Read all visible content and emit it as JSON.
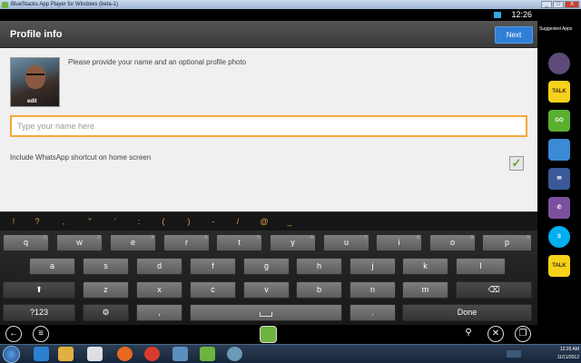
{
  "window": {
    "title": "BlueStacks App Player for Windows (beta-1)",
    "buttons": [
      "_",
      "□",
      "X"
    ]
  },
  "status_bar": {
    "time": "12:26"
  },
  "header": {
    "title": "Profile info",
    "next_label": "Next"
  },
  "profile": {
    "photo_edit_label": "edit",
    "prompt": "Please provide your name and an optional profile photo",
    "name_placeholder": "Type your name here",
    "shortcut_label": "Include WhatsApp shortcut on home screen",
    "shortcut_checked": true,
    "accent_color": "#f3a73c"
  },
  "symbols": [
    "!",
    "?",
    ",",
    "\"",
    "'",
    ":",
    "(",
    ")",
    "-",
    "/",
    "@",
    "_"
  ],
  "keyboard": {
    "row1": [
      {
        "key": "q",
        "hint": "1"
      },
      {
        "key": "w",
        "hint": "2"
      },
      {
        "key": "e",
        "hint": "3"
      },
      {
        "key": "r",
        "hint": "4"
      },
      {
        "key": "t",
        "hint": "5"
      },
      {
        "key": "y",
        "hint": "6"
      },
      {
        "key": "u",
        "hint": "7"
      },
      {
        "key": "i",
        "hint": "8"
      },
      {
        "key": "o",
        "hint": "9"
      },
      {
        "key": "p",
        "hint": "0"
      }
    ],
    "row2": [
      "a",
      "s",
      "d",
      "f",
      "g",
      "h",
      "j",
      "k",
      "l"
    ],
    "row3": [
      "z",
      "x",
      "c",
      "v",
      "b",
      "n",
      "m"
    ],
    "shift_icon": "shift-icon",
    "backspace_icon": "backspace-icon",
    "symbols_key": "?123",
    "settings_key": "⚙",
    "comma_key": ",",
    "period_key": ".",
    "done_key": "Done"
  },
  "nav": {
    "back": "←",
    "menu": "≡",
    "share": "share-icon",
    "settings": "wrench-icon",
    "windowed": "window-icon"
  },
  "right_panel": {
    "title": "Suggested Apps",
    "apps": [
      {
        "name": "swirl-app-icon",
        "label": "",
        "color": "#7a5a9a"
      },
      {
        "name": "kakaotalk-icon",
        "label": "TALK",
        "color": "#f7d21a"
      },
      {
        "name": "go-sms-icon",
        "label": "GO",
        "color": "#5bb030"
      },
      {
        "name": "contacts-app-icon",
        "label": "",
        "color": "#3a8ad6"
      },
      {
        "name": "messenger-icon",
        "label": "",
        "color": "#3b5998"
      },
      {
        "name": "viber-icon",
        "label": "",
        "color": "#7b519d"
      },
      {
        "name": "skype-icon",
        "label": "S",
        "color": "#00aff0"
      },
      {
        "name": "kakaotalk-icon-2",
        "label": "TALK",
        "color": "#f7d21a"
      }
    ]
  },
  "taskbar": {
    "time": "12:26 AM",
    "date": "11/11/2012"
  }
}
